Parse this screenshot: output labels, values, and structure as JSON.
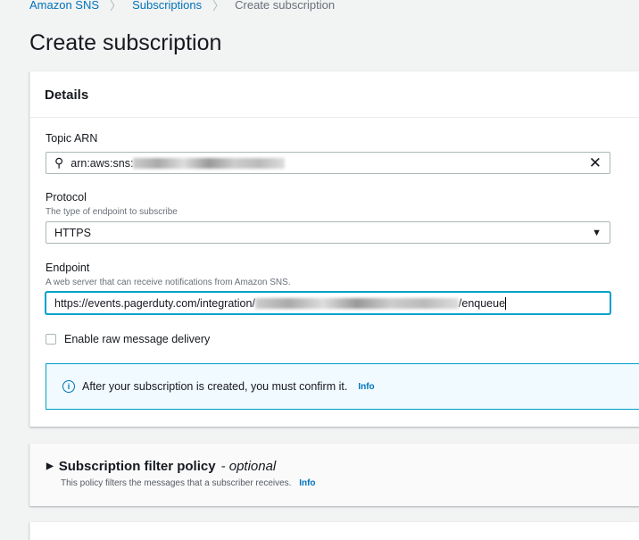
{
  "breadcrumb": [
    "Amazon SNS",
    "Subscriptions",
    "Create subscription"
  ],
  "page_title": "Create subscription",
  "details": {
    "title": "Details",
    "topic_arn": {
      "label": "Topic ARN",
      "value": "arn:aws:sns:"
    },
    "protocol": {
      "label": "Protocol",
      "description": "The type of endpoint to subscribe",
      "value": "HTTPS"
    },
    "endpoint": {
      "label": "Endpoint",
      "description": "A web server that can receive notifications from Amazon SNS.",
      "value_prefix": "https://events.pagerduty.com/integration/",
      "value_suffix": "/enqueue"
    },
    "raw_delivery": {
      "label": "Enable raw message delivery",
      "checked": false
    },
    "alert": {
      "text": "After your subscription is created, you must confirm it.",
      "link": "Info"
    }
  },
  "filter_policy": {
    "title": "Subscription filter policy",
    "optional": "- optional",
    "description": "This policy filters the messages that a subscriber receives.",
    "link": "Info"
  }
}
